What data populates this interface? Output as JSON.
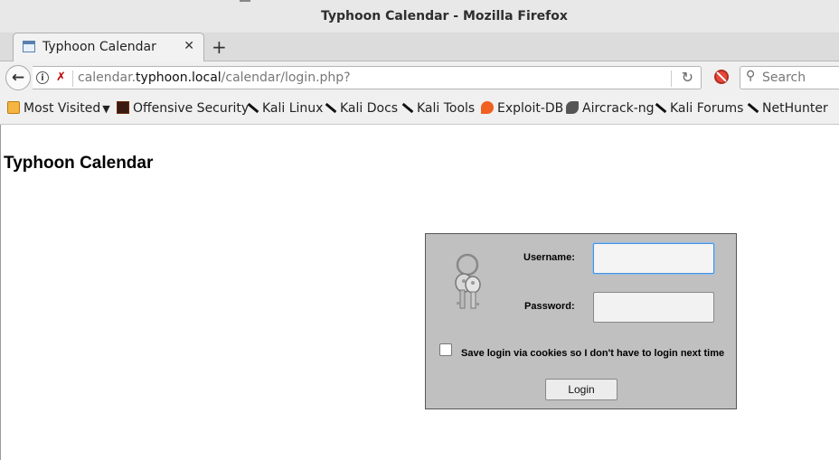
{
  "window": {
    "title": "Typhoon Calendar - Mozilla Firefox"
  },
  "tab": {
    "label": "Typhoon Calendar",
    "close": "✕",
    "new_tab": "+"
  },
  "navbar": {
    "url_prefix": "calendar.",
    "url_domain": "typhoon.local",
    "url_path": "/calendar/login.php?",
    "search_placeholder": "Search"
  },
  "bookmarks": [
    {
      "label": "Most Visited",
      "icon": "folder-icon"
    },
    {
      "label": "Offensive Security",
      "icon": "offsec-icon"
    },
    {
      "label": "Kali Linux",
      "icon": "kali-icon"
    },
    {
      "label": "Kali Docs",
      "icon": "kali-icon"
    },
    {
      "label": "Kali Tools",
      "icon": "kali-icon"
    },
    {
      "label": "Exploit-DB",
      "icon": "exploitdb-icon"
    },
    {
      "label": "Aircrack-ng",
      "icon": "aircrack-icon"
    },
    {
      "label": "Kali Forums",
      "icon": "kali-icon"
    },
    {
      "label": "NetHunter",
      "icon": "kali-icon"
    }
  ],
  "page": {
    "heading": "Typhoon Calendar",
    "login": {
      "username_label": "Username:",
      "password_label": "Password:",
      "remember_label": "Save login via cookies so I don't have to login next time",
      "button_label": "Login",
      "username_value": "",
      "password_value": ""
    }
  }
}
